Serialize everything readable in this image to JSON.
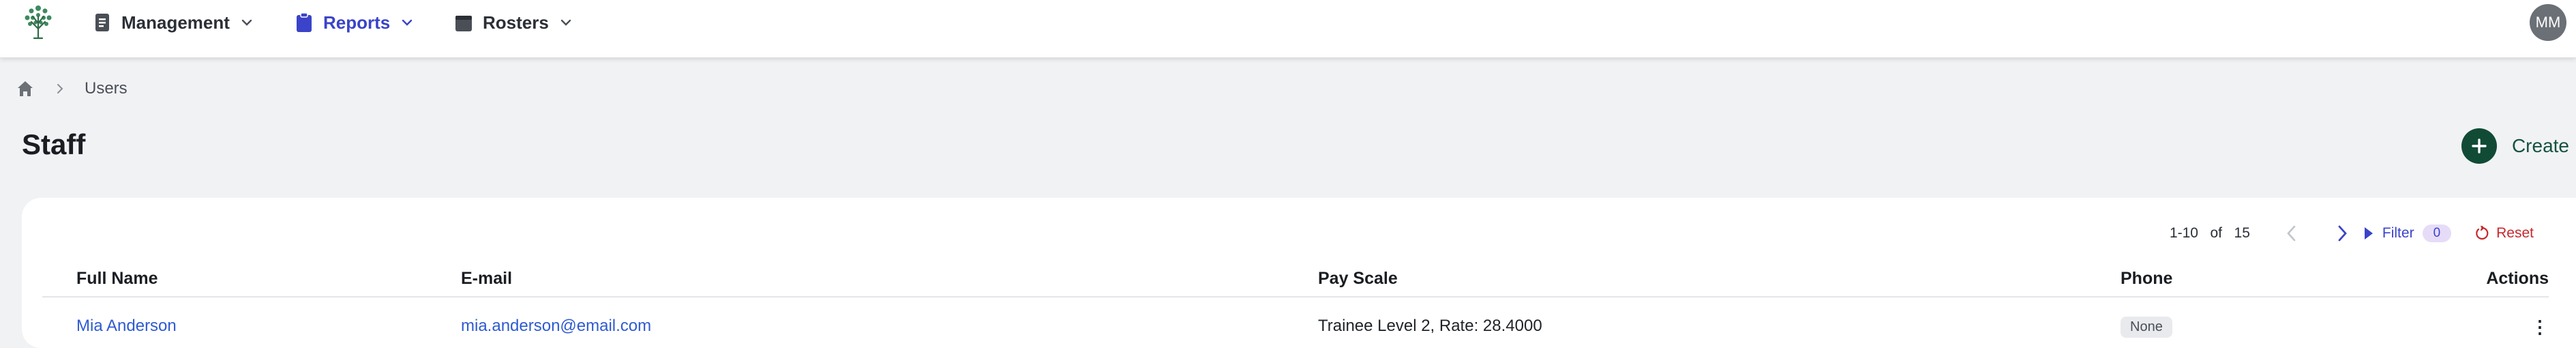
{
  "nav": {
    "items": [
      {
        "label": "Management",
        "icon": "document-icon"
      },
      {
        "label": "Reports",
        "icon": "clipboard-icon"
      },
      {
        "label": "Rosters",
        "icon": "calendar-icon"
      }
    ],
    "active_color": "#3a43c9",
    "avatar_initials": "MM"
  },
  "breadcrumb": {
    "items": [
      "Users"
    ]
  },
  "page": {
    "title": "Staff",
    "create_label": "Create"
  },
  "pager": {
    "range": "1-10",
    "of": "of",
    "total": "15",
    "filter_label": "Filter",
    "filter_count": "0",
    "reset_label": "Reset"
  },
  "table": {
    "columns": [
      "Full Name",
      "E-mail",
      "Pay Scale",
      "Phone",
      "Actions"
    ],
    "rows": [
      {
        "full_name": "Mia Anderson",
        "email": "mia.anderson@email.com",
        "pay_scale": "Trainee Level 2, Rate: 28.4000",
        "phone": "None"
      }
    ]
  },
  "colors": {
    "brand_green": "#114b36",
    "link_blue": "#2f5bd1",
    "reset_red": "#c6282d"
  }
}
